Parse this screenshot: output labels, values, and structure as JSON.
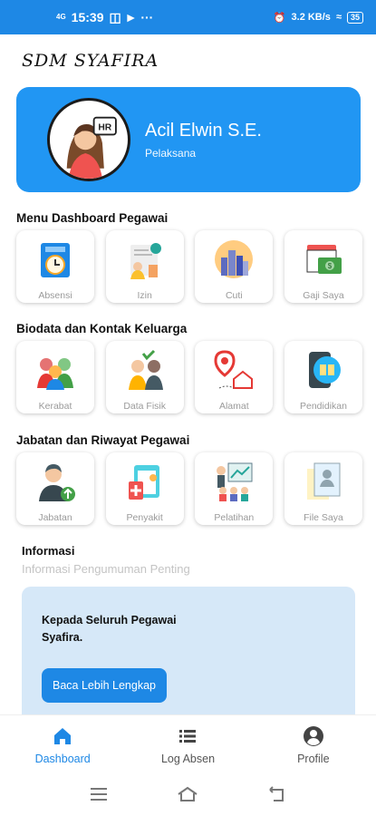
{
  "status_bar": {
    "time": "15:39",
    "network_label": "4G",
    "speed": "3.2 KB/s",
    "battery": "35"
  },
  "app": {
    "title": "SDM SYAFIRA"
  },
  "profile": {
    "name": "Acil Elwin S.E.",
    "role": "Pelaksana",
    "badge": "HR"
  },
  "sections": [
    {
      "title": "Menu Dashboard Pegawai",
      "items": [
        {
          "label": "Absensi",
          "icon": "attendance-clock-icon"
        },
        {
          "label": "Izin",
          "icon": "permission-icon"
        },
        {
          "label": "Cuti",
          "icon": "leave-city-icon"
        },
        {
          "label": "Gaji Saya",
          "icon": "salary-calendar-icon"
        }
      ]
    },
    {
      "title": "Biodata dan Kontak Keluarga",
      "items": [
        {
          "label": "Kerabat",
          "icon": "family-icon"
        },
        {
          "label": "Data Fisik",
          "icon": "physical-data-icon"
        },
        {
          "label": "Alamat",
          "icon": "address-pin-icon"
        },
        {
          "label": "Pendidikan",
          "icon": "education-book-icon"
        }
      ]
    },
    {
      "title": "Jabatan dan Riwayat Pegawai",
      "items": [
        {
          "label": "Jabatan",
          "icon": "position-promotion-icon"
        },
        {
          "label": "Penyakit",
          "icon": "medical-record-icon"
        },
        {
          "label": "Pelatihan",
          "icon": "training-board-icon"
        },
        {
          "label": "File Saya",
          "icon": "file-folder-icon"
        }
      ]
    }
  ],
  "info": {
    "title": "Informasi",
    "subtitle": "Informasi Pengumuman Penting",
    "message": "Kepada Seluruh Pegawai Syafira.",
    "button_label": "Baca Lebih Lengkap"
  },
  "bottom_nav": [
    {
      "label": "Dashboard",
      "icon": "home-icon",
      "active": true
    },
    {
      "label": "Log Absen",
      "icon": "list-icon",
      "active": false
    },
    {
      "label": "Profile",
      "icon": "account-icon",
      "active": false
    }
  ],
  "colors": {
    "primary": "#2196f3",
    "info_bg": "#d6e8f8",
    "label_gray": "#9a9a9a"
  }
}
